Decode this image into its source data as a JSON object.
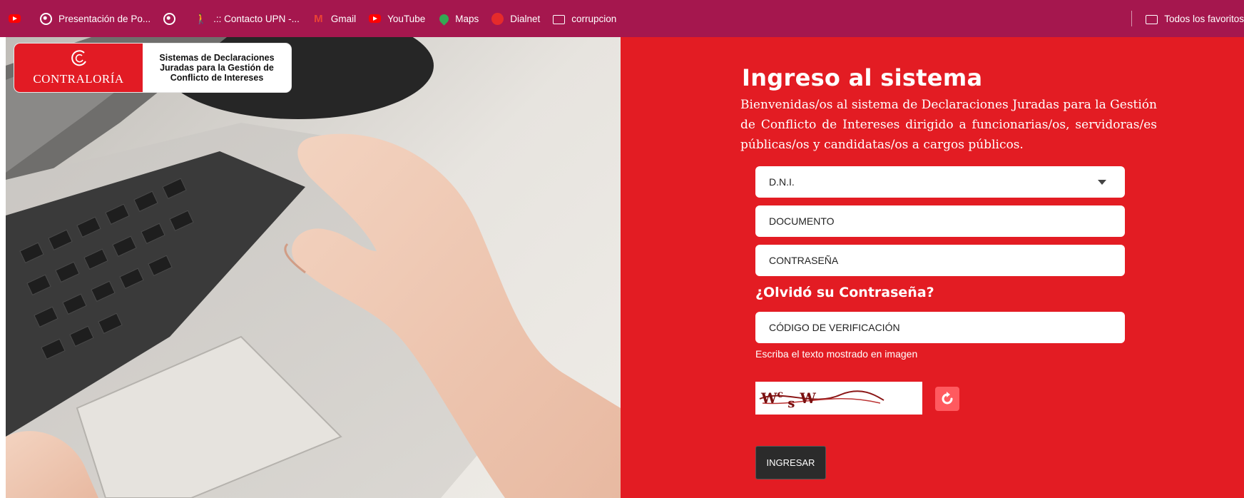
{
  "bookmarks": {
    "items": [
      {
        "label": "",
        "icon": "youtube-icon"
      },
      {
        "label": "Presentación de Po...",
        "icon": "globe-icon"
      },
      {
        "label": "",
        "icon": "globe-icon"
      },
      {
        "label": ".:: Contacto UPN -...",
        "icon": "figure-icon"
      },
      {
        "label": "Gmail",
        "icon": "gmail-icon"
      },
      {
        "label": "YouTube",
        "icon": "youtube-icon"
      },
      {
        "label": "Maps",
        "icon": "maps-icon"
      },
      {
        "label": "Dialnet",
        "icon": "dialnet-icon"
      },
      {
        "label": "corrupcion",
        "icon": "folder-icon"
      }
    ],
    "all_bookmarks": "Todos los favoritos"
  },
  "logo": {
    "name": "CONTRALORÍA",
    "subtitle": "Sistemas de Declaraciones Juradas para la Gestión de Conflicto de Intereses"
  },
  "login": {
    "title": "Ingreso al sistema",
    "intro": "Bienvenidas/os al sistema de Declaraciones Juradas para la Gestión de Conflicto de Intereses dirigido a funcionarias/os, servidoras/es públicas/os y candidatas/os a cargos públicos.",
    "doc_type": "D.N.I.",
    "document_placeholder": "DOCUMENTO",
    "password_placeholder": "CONTRASEÑA",
    "forgot_password": "¿Olvidó su Contraseña?",
    "verification_placeholder": "CÓDIGO DE VERIFICACIÓN",
    "captcha_hint": "Escriba el texto mostrado en imagen",
    "captcha_text": "WcsW",
    "submit": "INGRESAR"
  },
  "colors": {
    "bookmark_bar": "#a5174e",
    "panel_red": "#e31c23",
    "button_dark": "#2b2b2b",
    "refresh_button": "#ff5a5f"
  }
}
